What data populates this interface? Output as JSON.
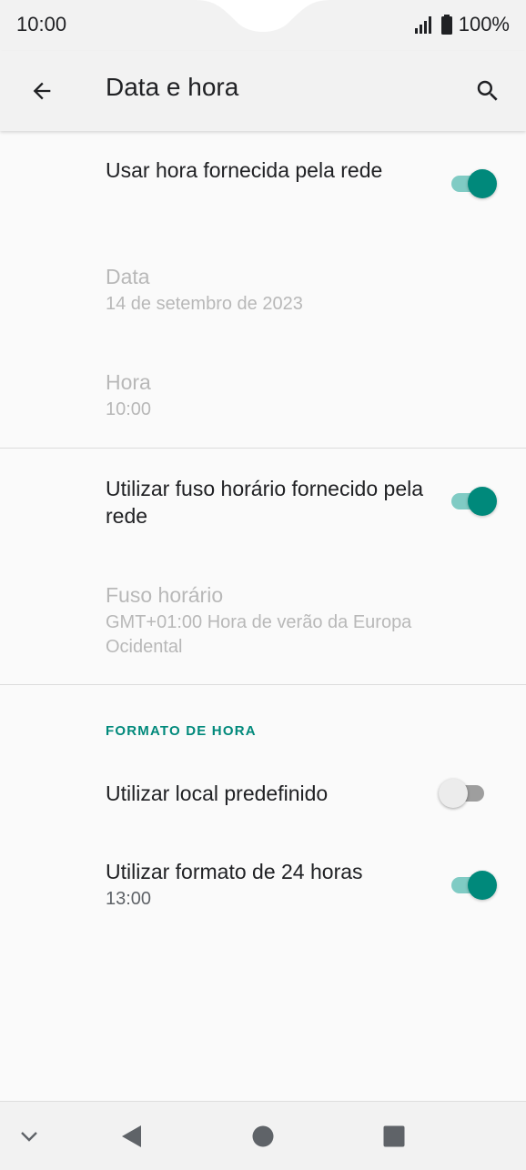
{
  "status_bar": {
    "time": "10:00",
    "battery": "100%",
    "icons": [
      "signal-icon",
      "battery-icon"
    ]
  },
  "app_bar": {
    "title": "Data e hora",
    "icons": [
      "back-arrow-icon",
      "search-icon"
    ]
  },
  "preferences": {
    "auto_time": {
      "title": "Usar hora fornecida pela rede",
      "checked": true
    },
    "date": {
      "title": "Data",
      "summary": "14 de setembro de 2023",
      "enabled": false
    },
    "time": {
      "title": "Hora",
      "summary": "10:00",
      "enabled": false
    },
    "auto_zone": {
      "title": "Utilizar fuso horário fornecido pela rede",
      "checked": true
    },
    "zone": {
      "title": "Fuso horário",
      "summary": "GMT+01:00 Hora de verão da Europa Ocidental",
      "enabled": false
    },
    "time_format_category": "FORMATO DE HORA",
    "locale_default": {
      "title": "Utilizar local predefinido",
      "checked": false
    },
    "format_24": {
      "title": "Utilizar formato de 24 horas",
      "summary": "13:00",
      "checked": true
    }
  },
  "colors": {
    "accent": "#00897b",
    "accent_track": "#80cbc4",
    "disabled_text": "#b8b8b8"
  },
  "nav_bar": {
    "icons": [
      "chevron-down-icon",
      "back-triangle-icon",
      "home-circle-icon",
      "recents-square-icon"
    ]
  }
}
